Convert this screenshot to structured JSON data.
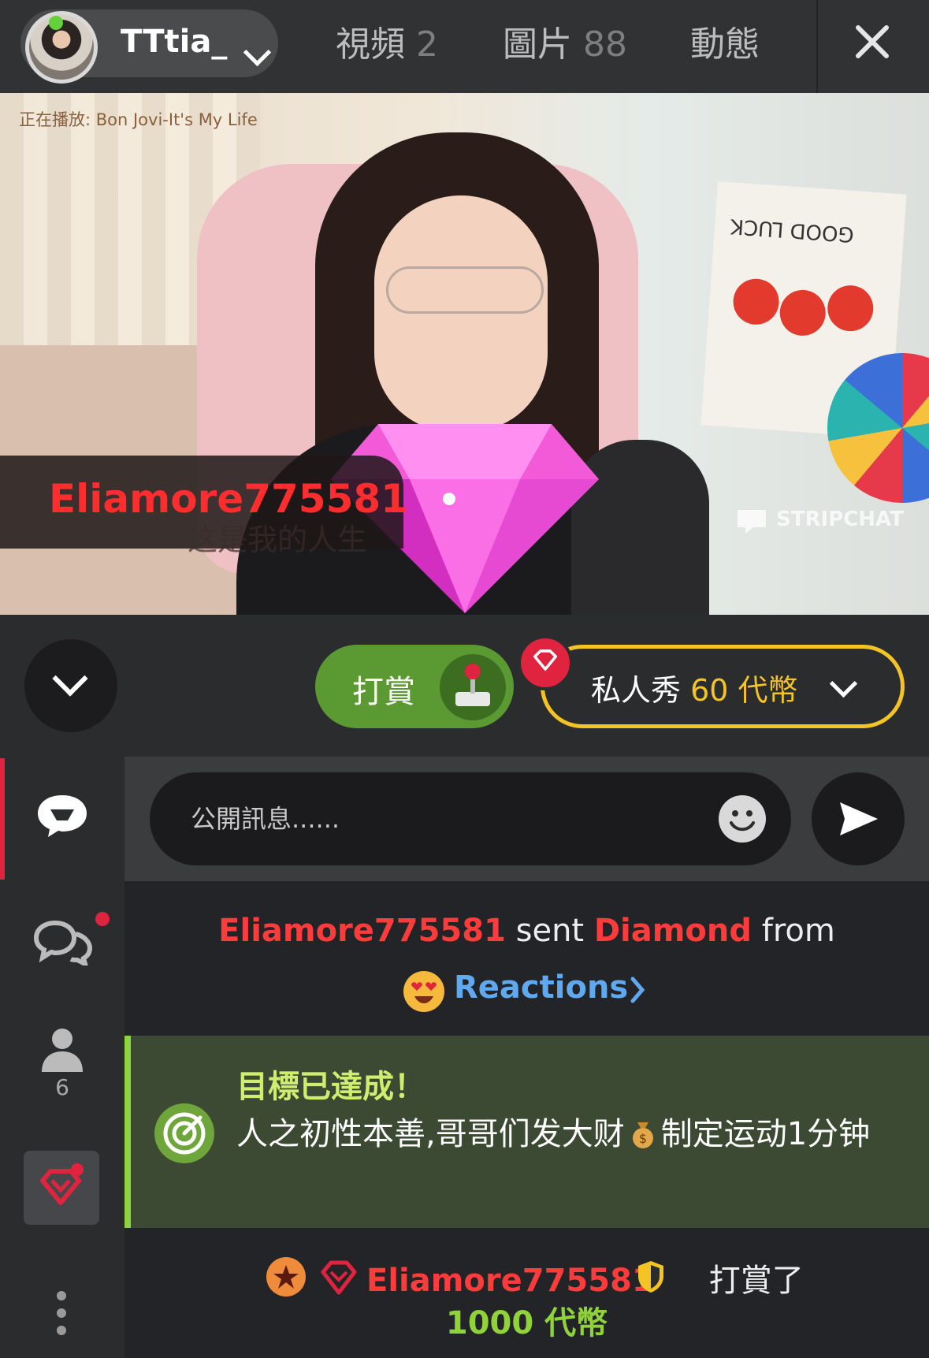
{
  "header": {
    "username": "TTtia_",
    "tabs": [
      {
        "label": "視頻",
        "count": "2"
      },
      {
        "label": "圖片",
        "count": "88"
      },
      {
        "label": "動態",
        "count": ""
      }
    ]
  },
  "video": {
    "now_playing": "正在播放: Bon Jovi-It's My Life",
    "gift_sender": "Eliamore775581",
    "subtitle": "这是我的人生",
    "watermark": "STRIPCHAT",
    "poster_text": "GOOD LUCK"
  },
  "actions": {
    "tip_label": "打賞",
    "private_label": "私人秀",
    "private_price": "60 代幣"
  },
  "sidebar": {
    "user_count": "6"
  },
  "chat": {
    "input_placeholder": "公開訊息......",
    "message1": {
      "sender": "Eliamore775581",
      "verb": "sent",
      "gift": "Diamond",
      "from": "from",
      "source": "Reactions"
    },
    "goal": {
      "title": "目標已達成！",
      "text_a": "人之初性本善,哥哥们发大财",
      "text_b": "制定运动1分钟"
    },
    "tip": {
      "sender": "Eliamore775581",
      "action": "打賞了",
      "amount": "1000 代幣"
    }
  },
  "colors": {
    "accent_red": "#ff3b3b",
    "tip_green": "#5b9a33",
    "private_gold": "#f3c424",
    "goal_green": "#8fd23a"
  }
}
